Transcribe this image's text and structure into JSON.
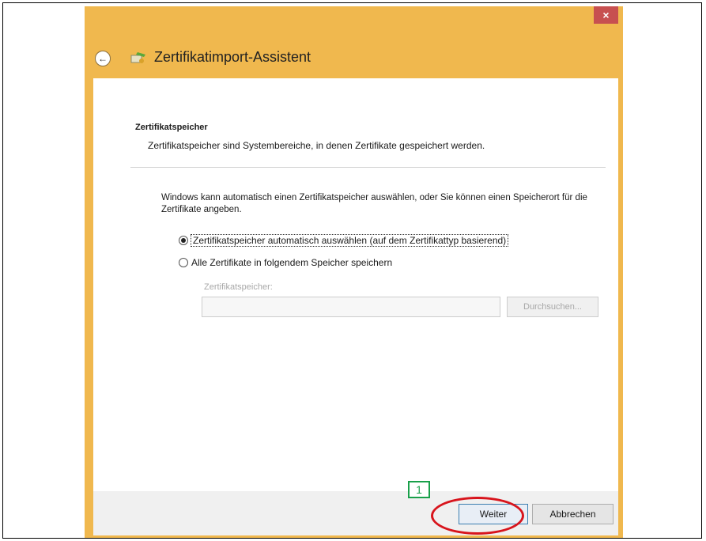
{
  "window": {
    "title": "Zertifikatimport-Assistent",
    "close_symbol": "×",
    "back_symbol": "←"
  },
  "section": {
    "heading": "Zertifikatspeicher",
    "description": "Zertifikatspeicher sind Systembereiche, in denen Zertifikate gespeichert werden."
  },
  "intro_text": "Windows kann automatisch einen Zertifikatspeicher auswählen, oder Sie können einen Speicherort für die Zertifikate angeben.",
  "options": {
    "auto": {
      "label": "Zertifikatspeicher automatisch auswählen (auf dem Zertifikattyp basierend)",
      "checked": true
    },
    "manual": {
      "label": "Alle Zertifikate in folgendem Speicher speichern",
      "checked": false
    }
  },
  "store": {
    "label": "Zertifikatspeicher:",
    "value": "",
    "browse_label": "Durchsuchen..."
  },
  "buttons": {
    "next_label": "Weiter",
    "cancel_label": "Abbrechen"
  },
  "annotation": {
    "step_number": "1",
    "badge_color": "#19a04a",
    "ellipse_color": "#d8141c"
  }
}
